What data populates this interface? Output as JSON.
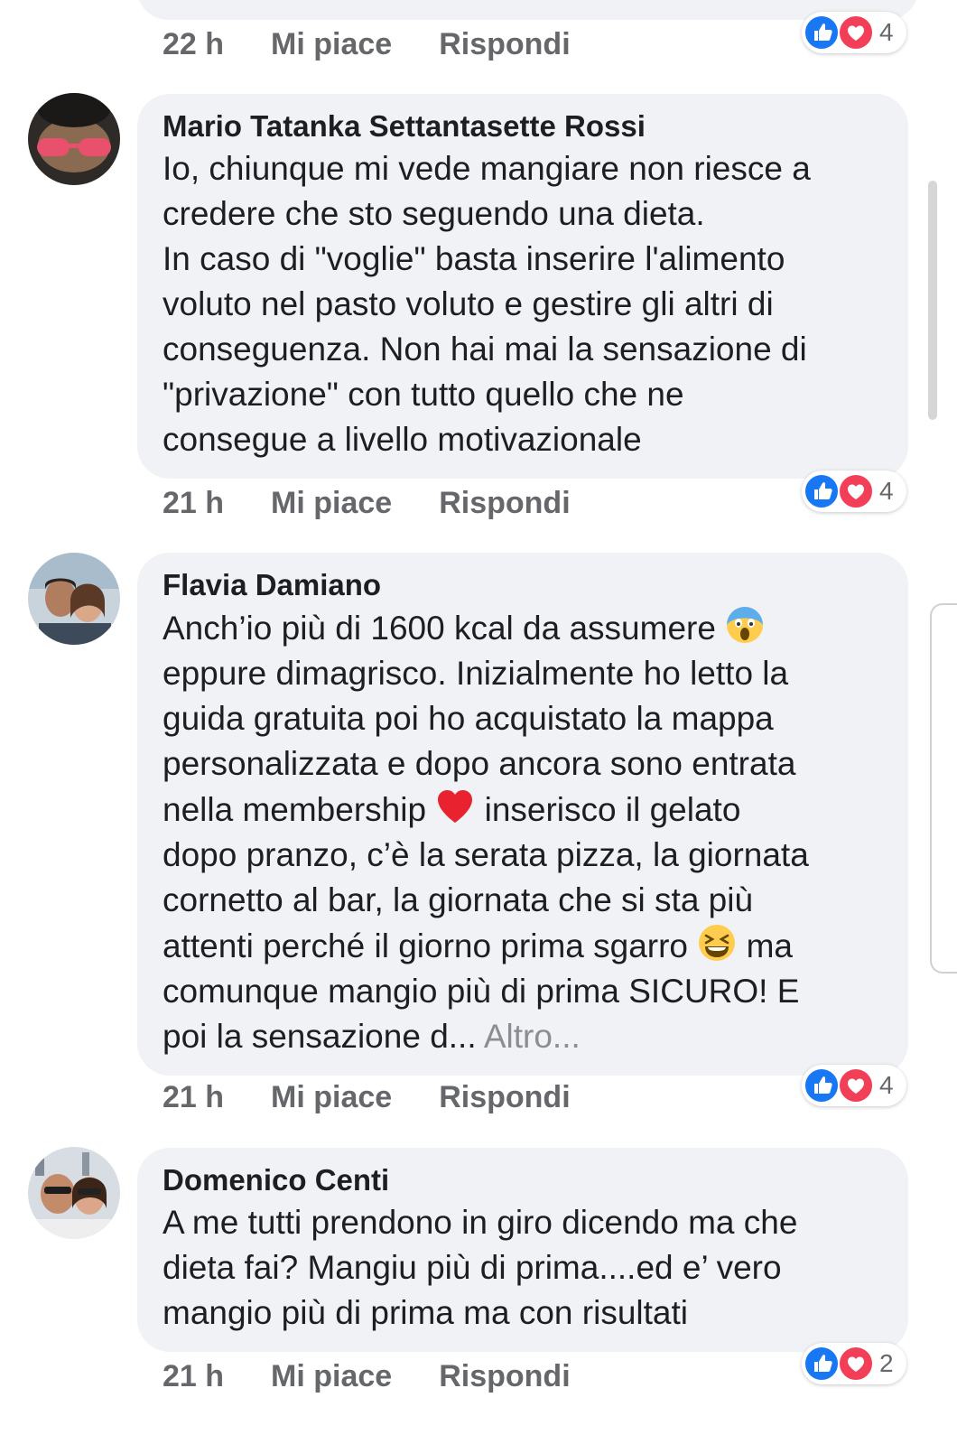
{
  "comments": [
    {
      "time": "22 h",
      "like_label": "Mi piace",
      "reply_label": "Rispondi",
      "reaction_count": "4"
    },
    {
      "author": "Mario Tatanka Settantasette Rossi",
      "text": "Io, chiunque mi vede mangiare non riesce a\ncredere che sto seguendo una dieta.\nIn caso di \"voglie\" basta inserire l'alimento\nvoluto nel pasto voluto e gestire gli altri di\nconseguenza. Non hai mai la sensazione di\n\"privazione\" con tutto quello che ne\nconsegue a livello motivazionale",
      "time": "21 h",
      "like_label": "Mi piace",
      "reply_label": "Rispondi",
      "reaction_count": "4"
    },
    {
      "author": "Flavia Damiano",
      "text_part1": "Anch’io più di 1600 kcal da assumere ",
      "text_part2": "\neppure dimagrisco. Inizialmente ho letto la\nguida gratuita poi ho acquistato la mappa\npersonalizzata e dopo ancora sono entrata\nnella membership ",
      "text_part3": " inserisco il gelato\ndopo pranzo, c’è la serata pizza, la giornata\ncornetto al bar, la giornata che si sta più\nattenti perché il giorno prima sgarro ",
      "text_part4": " ma\ncomunque mangio più di prima SICURO! E\npoi la sensazione d... ",
      "more_label": "Altro...",
      "time": "21 h",
      "like_label": "Mi piace",
      "reply_label": "Rispondi",
      "reaction_count": "4"
    },
    {
      "author": "Domenico Centi",
      "text": "A me tutti prendono in giro dicendo ma che\ndieta fai? Mangiu più di prima....ed e’ vero\nmangio più di prima ma con risultati",
      "time": "21 h",
      "like_label": "Mi piace",
      "reply_label": "Rispondi",
      "reaction_count": "2"
    }
  ],
  "icons": {
    "like": "thumbs-up-icon",
    "love": "heart-icon",
    "emoji_scream": "face-screaming-emoji",
    "emoji_heart": "red-heart-emoji",
    "emoji_laugh": "grinning-squinting-emoji"
  },
  "colors": {
    "bubble": "#f0f2f5",
    "like_blue": "#1877f2",
    "love_red": "#f33e58",
    "meta_gray": "#65676b"
  }
}
